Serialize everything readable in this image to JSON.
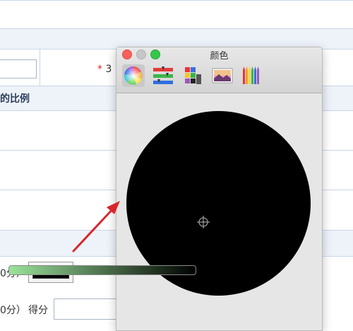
{
  "panel": {
    "title": "颜色",
    "tools": [
      {
        "name": "color-wheel-icon",
        "selected": true
      },
      {
        "name": "color-sliders-icon",
        "selected": false
      },
      {
        "name": "color-palettes-icon",
        "selected": false
      },
      {
        "name": "image-palettes-icon",
        "selected": false
      },
      {
        "name": "pencils-icon",
        "selected": false
      }
    ],
    "wheel_color": "#000000",
    "slider_gradient": [
      "#9be39b",
      "#000000"
    ]
  },
  "form": {
    "row1": {
      "star": "*",
      "label": "3"
    },
    "section": "的比例",
    "row_color": {
      "label": "0分）"
    },
    "row_score": {
      "label": "0分）",
      "score_label": "得分"
    },
    "swatch_color": "#000000"
  },
  "annotation": {
    "arrow_color": "#d8272c"
  }
}
